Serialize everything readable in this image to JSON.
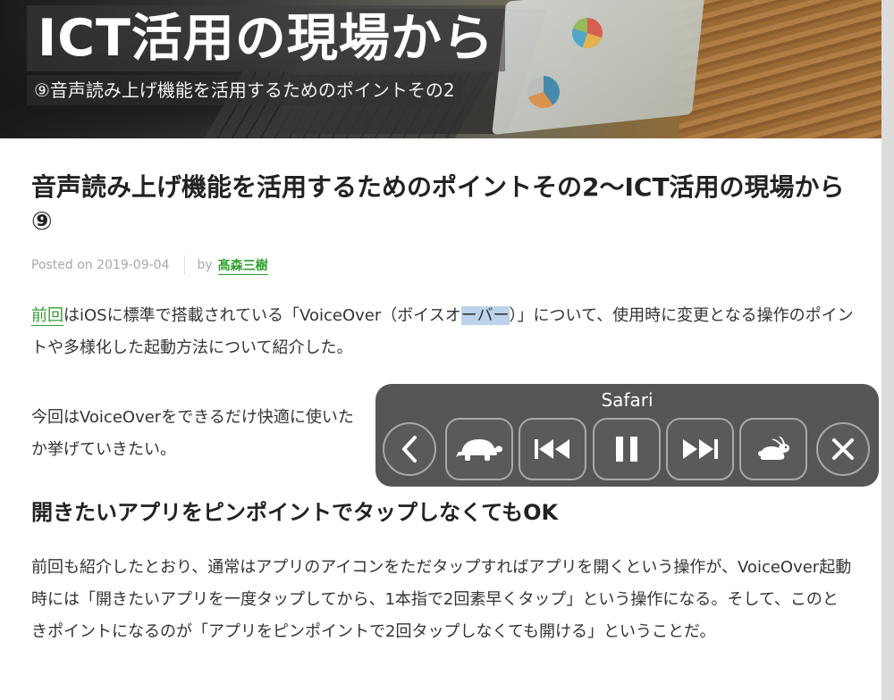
{
  "banner": {
    "title": "ICT活用の現場から",
    "subtitle": "⑨音声読み上げ機能を活用するためのポイントその2"
  },
  "article": {
    "title": "音声読み上げ機能を活用するためのポイントその2〜ICT活用の現場から⑨",
    "meta": {
      "posted_on": "Posted on 2019-09-04",
      "by": "by",
      "author": "髙森三樹"
    },
    "p1": {
      "link": "前回",
      "text_a": "はiOSに標準で搭載されている「VoiceOver（ボイスオ",
      "highlight": "ーバー",
      "text_b": "）」について、使用時に変更となる操作のポイントや多様化した起動方法について紹介した。"
    },
    "p2": {
      "text": "今回はVoiceOverをできるだけ快適に使いた",
      "text_b": "か挙げていきたい。"
    },
    "section_heading": "開きたいアプリをピンポイントでタップしなくてもOK",
    "p4": "前回も紹介したとおり、通常はアプリのアイコンをただタップすればアプリを開くという操作が、VoiceOver起動時には「開きたいアプリを一度タップしてから、1本指で2回素早くタップ」という操作になる。そして、このときポイントになるのが「アプリをピンポイントで2回タップしなくても開ける」ということだ。"
  },
  "speak_controller": {
    "title": "Safari",
    "buttons": [
      {
        "icon": "chevron-left-icon"
      },
      {
        "icon": "turtle-icon"
      },
      {
        "icon": "skip-back-icon"
      },
      {
        "icon": "pause-icon"
      },
      {
        "icon": "skip-forward-icon"
      },
      {
        "icon": "rabbit-icon"
      },
      {
        "icon": "close-icon"
      }
    ]
  },
  "colors": {
    "link": "#2ea02e",
    "panel": "#464646",
    "highlight": "#bcd3ec"
  }
}
